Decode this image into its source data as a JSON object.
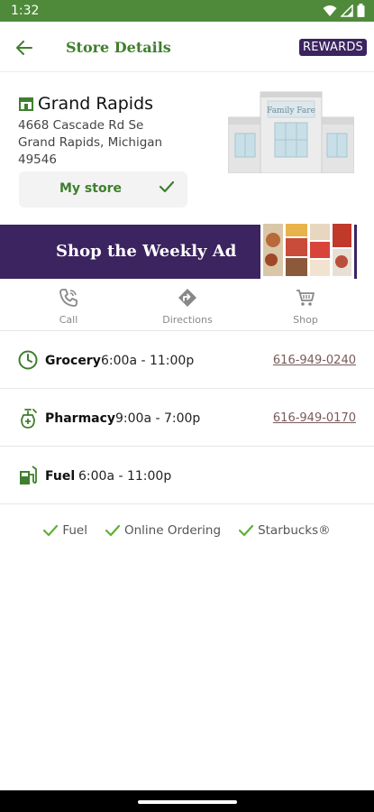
{
  "status": {
    "time": "1:32"
  },
  "header": {
    "title": "Store Details",
    "rewards_label": "REWARDS"
  },
  "store": {
    "name": "Grand Rapids",
    "address_line1": "4668 Cascade Rd Se",
    "address_line2": "Grand Rapids, Michigan",
    "zip": "49546",
    "my_store_label": "My store",
    "illustration_sign": "Family Fare"
  },
  "weekly_ad": {
    "label": "Shop the Weekly Ad"
  },
  "actions": [
    {
      "label": "Call",
      "icon": "phone-icon"
    },
    {
      "label": "Directions",
      "icon": "directions-icon"
    },
    {
      "label": "Shop",
      "icon": "cart-icon"
    }
  ],
  "departments": [
    {
      "name": "Grocery",
      "hours": "6:00a - 11:00p",
      "phone": "616-949-0240",
      "icon": "clock-icon"
    },
    {
      "name": "Pharmacy",
      "hours": "9:00a - 7:00p",
      "phone": "616-949-0170",
      "icon": "pharmacy-icon"
    },
    {
      "name": "Fuel",
      "hours": "6:00a - 11:00p",
      "phone": "",
      "icon": "fuel-icon"
    }
  ],
  "amenities": [
    "Fuel",
    "Online Ordering",
    "Starbucks®"
  ],
  "colors": {
    "brand_green": "#3f7f2d",
    "brand_purple": "#3b2460",
    "status_green": "#4f8a3a",
    "check_green": "#5fb230"
  }
}
